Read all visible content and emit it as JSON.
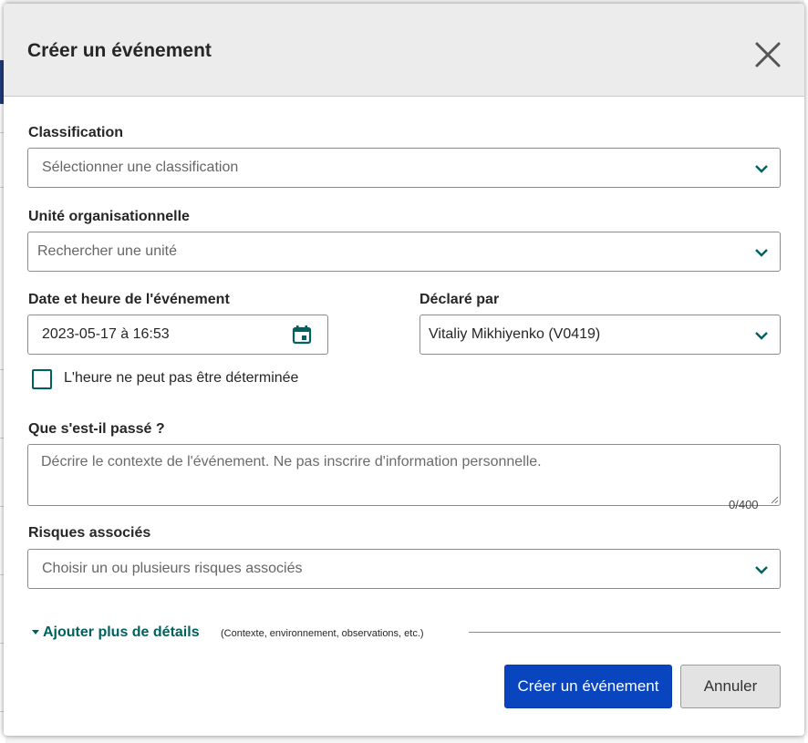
{
  "modal": {
    "title": "Créer un événement"
  },
  "classification": {
    "label": "Classification",
    "placeholder": "Sélectionner une classification"
  },
  "unit": {
    "label": "Unité organisationnelle",
    "placeholder": "Rechercher une unité"
  },
  "event_datetime": {
    "label": "Date et heure de l'événement",
    "value": "2023-05-17 à 16:53"
  },
  "reported_by": {
    "label": "Déclaré par",
    "value": "Vitaliy Mikhiyenko (V0419)"
  },
  "time_unknown": {
    "label": "L'heure ne peut pas être déterminée",
    "checked": false
  },
  "what_happened": {
    "label": "Que s'est-il passé ?",
    "placeholder": "Décrire le contexte de l'événement. Ne pas inscrire d'information personnelle.",
    "counter": "0/400"
  },
  "risks": {
    "label": "Risques associés",
    "placeholder": "Choisir un ou plusieurs risques associés"
  },
  "more_details": {
    "link": "Ajouter plus de détails",
    "hint": "(Contexte, environnement, observations, etc.)"
  },
  "actions": {
    "create": "Créer un événement",
    "cancel": "Annuler"
  },
  "colors": {
    "primary": "#0a45c0",
    "accent_teal": "#00615f",
    "header_bg": "#ececec"
  },
  "icons": [
    "close-icon",
    "chevron-down-icon",
    "calendar-icon",
    "caret-down-icon",
    "resize-handle-icon"
  ]
}
